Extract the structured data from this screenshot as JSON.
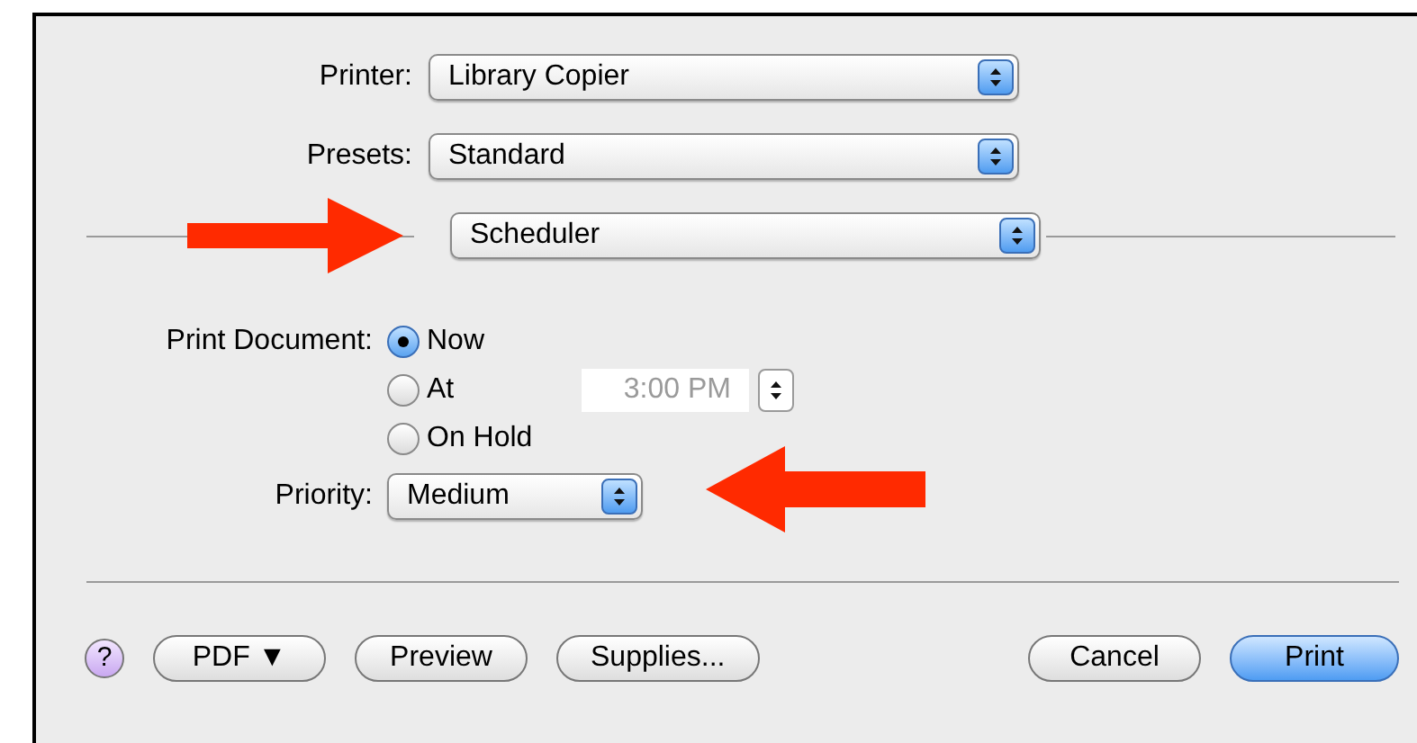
{
  "printer": {
    "label": "Printer:",
    "value": "Library Copier"
  },
  "presets": {
    "label": "Presets:",
    "value": "Standard"
  },
  "panel": {
    "value": "Scheduler"
  },
  "print_document": {
    "label": "Print Document:",
    "options": [
      {
        "label": "Now",
        "selected": true
      },
      {
        "label": "At",
        "selected": false
      },
      {
        "label": "On Hold",
        "selected": false
      }
    ],
    "time": {
      "value": "3:00 PM",
      "disabled": true
    }
  },
  "priority": {
    "label": "Priority:",
    "value": "Medium"
  },
  "buttons": [
    {
      "kind": "help",
      "label": "?"
    },
    {
      "kind": "plain",
      "label": "PDF ▼"
    },
    {
      "kind": "plain",
      "label": "Preview"
    },
    {
      "kind": "plain",
      "label": "Supplies..."
    },
    {
      "kind": "gap"
    },
    {
      "kind": "plain",
      "label": "Cancel"
    },
    {
      "kind": "default",
      "label": "Print"
    }
  ]
}
